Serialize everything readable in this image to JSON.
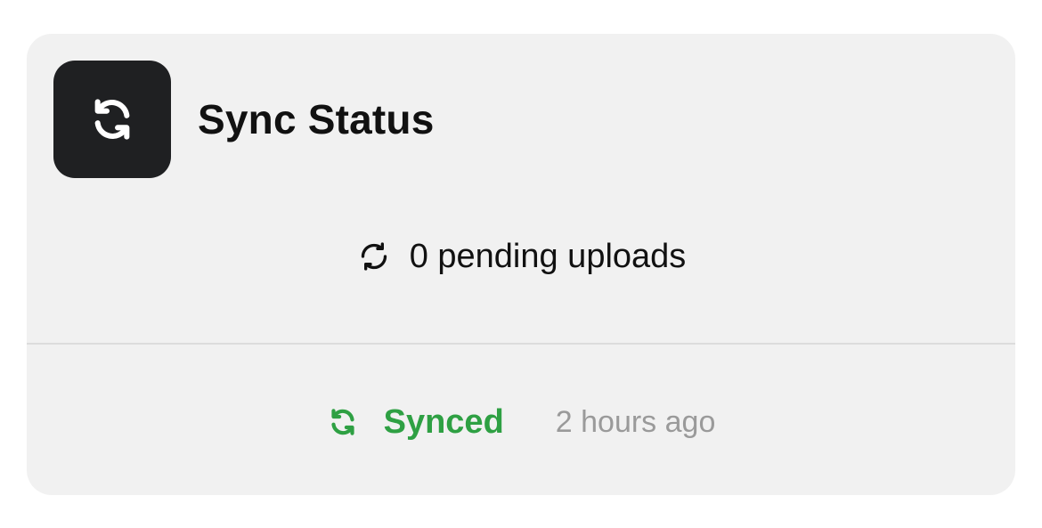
{
  "card": {
    "title": "Sync Status",
    "app_icon": "sync-icon",
    "pending": {
      "icon": "refresh-icon",
      "text": "0 pending uploads"
    },
    "footer": {
      "status_icon": "sync-icon",
      "status_label": "Synced",
      "last_sync": "2 hours ago",
      "status_color": "#2ea043"
    }
  }
}
